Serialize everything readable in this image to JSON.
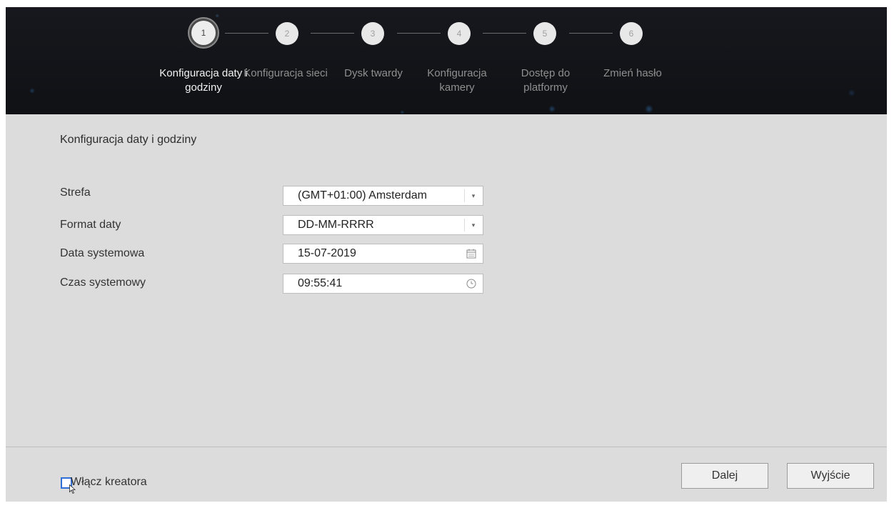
{
  "wizard": {
    "steps": [
      {
        "number": "1",
        "label": "Konfiguracja daty i godziny",
        "active": true
      },
      {
        "number": "2",
        "label": "Konfiguracja sieci",
        "active": false
      },
      {
        "number": "3",
        "label": "Dysk twardy",
        "active": false
      },
      {
        "number": "4",
        "label": "Konfiguracja kamery",
        "active": false
      },
      {
        "number": "5",
        "label": "Dostęp do platformy",
        "active": false
      },
      {
        "number": "6",
        "label": "Zmień hasło",
        "active": false
      }
    ]
  },
  "section": {
    "title": "Konfiguracja daty i godziny"
  },
  "fields": {
    "timezone": {
      "label": "Strefa",
      "value": "(GMT+01:00) Amsterdam"
    },
    "date_format": {
      "label": "Format daty",
      "value": "DD-MM-RRRR"
    },
    "system_date": {
      "label": "Data systemowa",
      "value": "15-07-2019"
    },
    "system_time": {
      "label": "Czas systemowy",
      "value": "09:55:41"
    }
  },
  "footer": {
    "wizard_checkbox_label": "Włącz kreatora",
    "wizard_checkbox_checked": false,
    "next_label": "Dalej",
    "exit_label": "Wyjście"
  },
  "colors": {
    "header_bg": "#121419",
    "panel_bg": "#dcdcdc",
    "checkbox_border": "#2f6fd6"
  },
  "icons": {
    "dropdown": "chevron-down-icon",
    "date": "calendar-icon",
    "time": "clock-icon"
  }
}
